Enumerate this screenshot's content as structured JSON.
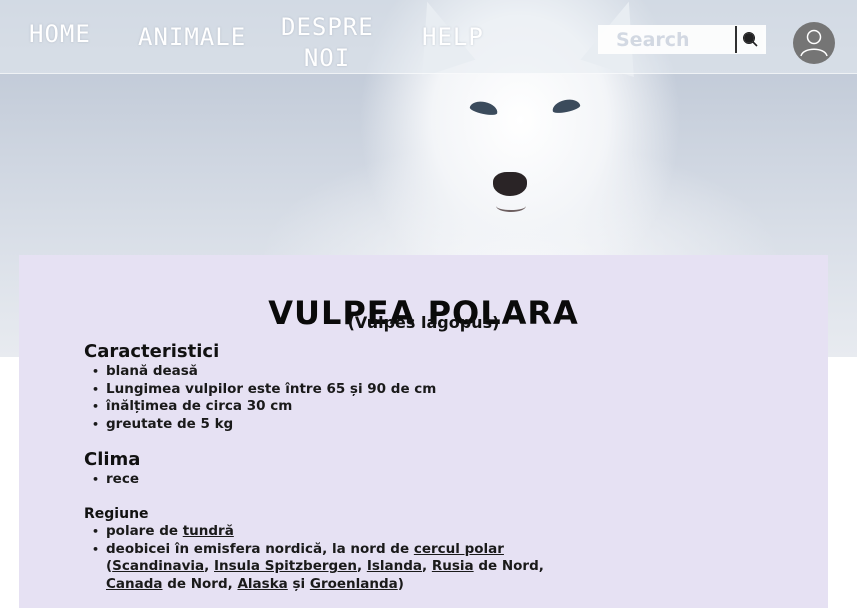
{
  "nav": {
    "home": "HOME",
    "animale": "ANIMALE",
    "despre_line1": "DESPRE",
    "despre_line2": "NOI",
    "help": "HELP"
  },
  "search": {
    "placeholder": "Search",
    "button_icon": "search-icon"
  },
  "user": {
    "icon": "user-icon"
  },
  "page": {
    "title": "VULPEA POLARA",
    "subtitle": "(Vulpes lagopus)"
  },
  "sections": {
    "caracteristici": {
      "heading": "Caracteristici",
      "items": [
        "blană deasă",
        "Lungimea vulpilor este între 65 și 90 de cm",
        "înălțimea de circa 30 cm",
        "greutate de 5 kg"
      ]
    },
    "clima": {
      "heading": "Clima",
      "items": [
        "rece"
      ]
    },
    "regiune": {
      "heading": "Regiune",
      "item1_prefix": "polare de ",
      "item1_link": "tundră",
      "item2_prefix": "deobicei în emisfera nordică, la nord de ",
      "item2_link": "cercul polar",
      "item3_open": "(",
      "link_scandinavia": "Scandinavia",
      "sep1": ", ",
      "link_spitzbergen": "Insula Spitzbergen",
      "sep2": ", ",
      "link_islanda": "Islanda",
      "sep3": ", ",
      "link_rusia": "Rusia",
      "text_denord1": " de Nord,",
      "link_canada": "Canada",
      "text_denord2": " de Nord, ",
      "link_alaska": "Alaska",
      "text_si": " și ",
      "link_groenlanda": "Groenlanda",
      "item3_close": ")"
    }
  },
  "colors": {
    "card_bg": "#e6e1f3",
    "avatar_bg": "#757575",
    "nav_text": "#ffffff"
  }
}
